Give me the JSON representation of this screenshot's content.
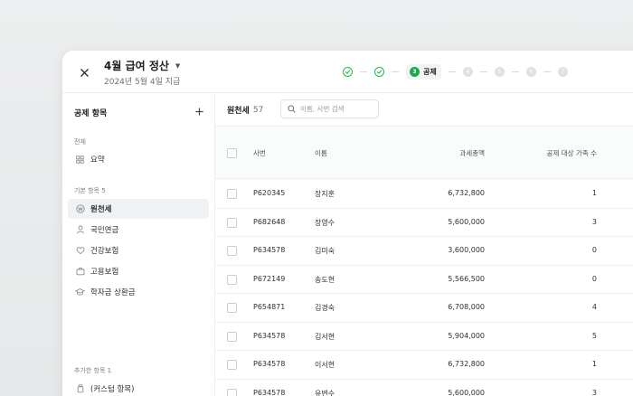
{
  "header": {
    "title": "4월 급여 정산",
    "subtitle": "2024년 5월 4일 지급",
    "current_step_number": "3",
    "current_step_label": "공제",
    "todo_steps": [
      "4",
      "5",
      "6",
      "7"
    ]
  },
  "sidebar": {
    "title": "공제 항목",
    "group_all": "전체",
    "summary_label": "요약",
    "group_basic": "기본 항목 5",
    "basic_items": [
      "원천세",
      "국민연금",
      "건강보험",
      "고용보험",
      "학자금 상환금"
    ],
    "group_added": "추가한 항목 1",
    "added_items": [
      "(커스텀 항목)"
    ]
  },
  "main": {
    "title": "원천세",
    "count": "57",
    "search_placeholder": "이름, 사번 검색",
    "columns": {
      "id": "사번",
      "name": "이름",
      "total": "과세총액",
      "dependents": "공제 대상 가족 수"
    },
    "rows": [
      {
        "id": "P620345",
        "name": "장지훈",
        "total": "6,732,800",
        "dependents": "1"
      },
      {
        "id": "P682648",
        "name": "장영수",
        "total": "5,600,000",
        "dependents": "3"
      },
      {
        "id": "P634578",
        "name": "김미숙",
        "total": "3,600,000",
        "dependents": "0"
      },
      {
        "id": "P672149",
        "name": "송도현",
        "total": "5,566,500",
        "dependents": "0"
      },
      {
        "id": "P654871",
        "name": "김경숙",
        "total": "6,708,000",
        "dependents": "4"
      },
      {
        "id": "P634578",
        "name": "김서현",
        "total": "5,904,000",
        "dependents": "5"
      },
      {
        "id": "P634578",
        "name": "이서현",
        "total": "6,732,800",
        "dependents": "1"
      },
      {
        "id": "P634578",
        "name": "유변수",
        "total": "5,600,000",
        "dependents": "3"
      }
    ]
  },
  "colors": {
    "accent_green": "#1fa84a",
    "step_done": "#2db34a",
    "step_todo": "#dfe2e5"
  }
}
